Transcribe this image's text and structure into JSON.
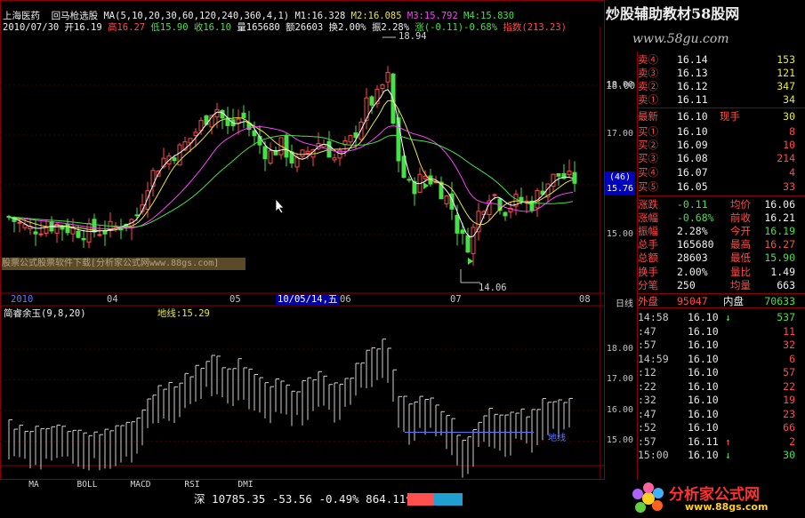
{
  "header": {
    "stock_name": "上海医药",
    "indicator_name": "回马枪选股",
    "ma_params": "MA(5,10,20,30,60,120,240,360,4,1)",
    "ma1": "M1:16.328",
    "ma2": "M2:16.085",
    "ma3": "M3:15.792",
    "ma4": "M4:15.830",
    "line2_date": "2010/07/30",
    "open": "开16.19",
    "high": "高16.27",
    "low": "低15.90",
    "close": "收16.10",
    "volume": "量165680",
    "amount": "额26603",
    "turnover": "换2.00%",
    "amplitude": "振2.28%",
    "change": "涨(-0.11)-0.68%",
    "index": "指数(213.23)"
  },
  "watermark": {
    "title": "炒股辅助教材58股网",
    "url": "www.58gu.com",
    "notice": "股票公式股票软件下载[分析家公式网www.88gs.com]"
  },
  "price_axis": {
    "labels": [
      "18.00",
      "17.00",
      "16.00",
      "15.00"
    ],
    "tag": "(46)",
    "current": "15.76"
  },
  "annotations": {
    "high": "18.94",
    "low": "14.06"
  },
  "time_axis": {
    "labels": [
      "2010",
      "04",
      "05",
      "10/05/14,五",
      "06",
      "07",
      "08"
    ],
    "mode": "日线"
  },
  "sub_indicator": {
    "name": "简睿余玉",
    "params": "(9,8,20)",
    "extra": "地线:15.29",
    "ground_label": "地线",
    "axis": [
      "18.00",
      "17.00",
      "16.00",
      "15.00"
    ]
  },
  "order_book": {
    "asks": [
      {
        "label": "卖④",
        "price": "16.14",
        "vol": "153"
      },
      {
        "label": "卖③",
        "price": "16.13",
        "vol": "121"
      },
      {
        "label": "卖②",
        "price": "16.12",
        "vol": "347"
      },
      {
        "label": "卖①",
        "price": "16.11",
        "vol": "34"
      }
    ],
    "latest": {
      "label": "最新",
      "price": "16.10",
      "hand_label": "现手",
      "hand": "30"
    },
    "bids": [
      {
        "label": "买①",
        "price": "16.10",
        "vol": "8"
      },
      {
        "label": "买②",
        "price": "16.09",
        "vol": "10"
      },
      {
        "label": "买③",
        "price": "16.08",
        "vol": "214"
      },
      {
        "label": "买④",
        "price": "16.07",
        "vol": "4"
      },
      {
        "label": "买⑤",
        "price": "16.05",
        "vol": "33"
      }
    ]
  },
  "stats": [
    {
      "l1": "涨跌",
      "v1": "-0.11",
      "l2": "均价",
      "v2": "16.06"
    },
    {
      "l1": "涨幅",
      "v1": "-0.68%",
      "l2": "前收",
      "v2": "16.21"
    },
    {
      "l1": "振幅",
      "v1": "2.28%",
      "l2": "今开",
      "v2": "16.19"
    },
    {
      "l1": "总手",
      "v1": "165680",
      "l2": "最高",
      "v2": "16.27"
    },
    {
      "l1": "总额",
      "v1": "28603",
      "l2": "最低",
      "v2": "15.90"
    },
    {
      "l1": "换手",
      "v1": "2.00%",
      "l2": "量比",
      "v2": "1.49"
    },
    {
      "l1": "分笔",
      "v1": "250",
      "l2": "均量",
      "v2": "663"
    }
  ],
  "outer": {
    "label": "外盘",
    "value": "95047",
    "inner_label": "内盘",
    "inner_value": "70633"
  },
  "ticks": [
    {
      "t": "14:58",
      "p": "16.10",
      "a": "↓",
      "v": "537"
    },
    {
      "t": ":47",
      "p": "16.10",
      "a": "",
      "v": "11"
    },
    {
      "t": ":57",
      "p": "16.10",
      "a": "",
      "v": "32"
    },
    {
      "t": "14:59",
      "p": "16.10",
      "a": "",
      "v": "6"
    },
    {
      "t": ":12",
      "p": "16.10",
      "a": "",
      "v": "57"
    },
    {
      "t": ":22",
      "p": "16.10",
      "a": "",
      "v": "22"
    },
    {
      "t": ":32",
      "p": "16.10",
      "a": "",
      "v": "19"
    },
    {
      "t": ":47",
      "p": "16.10",
      "a": "",
      "v": "23"
    },
    {
      "t": ":52",
      "p": "16.10",
      "a": "",
      "v": "66"
    },
    {
      "t": ":57",
      "p": "16.11",
      "a": "↑",
      "v": "2"
    },
    {
      "t": "15:00",
      "p": "16.10",
      "a": "↓",
      "v": "30"
    }
  ],
  "tabs": [
    "MA",
    "BOLL",
    "MACD",
    "RSI",
    "DMI"
  ],
  "status": {
    "market": "深",
    "index": "10785.35",
    "change": "-53.56",
    "pct": "-0.49%",
    "amount": "864.11亿"
  },
  "logo": {
    "text": "分析家公式网",
    "url": "www.88gs.com"
  },
  "colors": {
    "up": "#ff4a4a",
    "down": "#48e048",
    "grid": "#8b0000",
    "ma1": "#ffffff",
    "ma2": "#e8e840",
    "ma3": "#ff40ff",
    "ma4": "#48e048"
  }
}
